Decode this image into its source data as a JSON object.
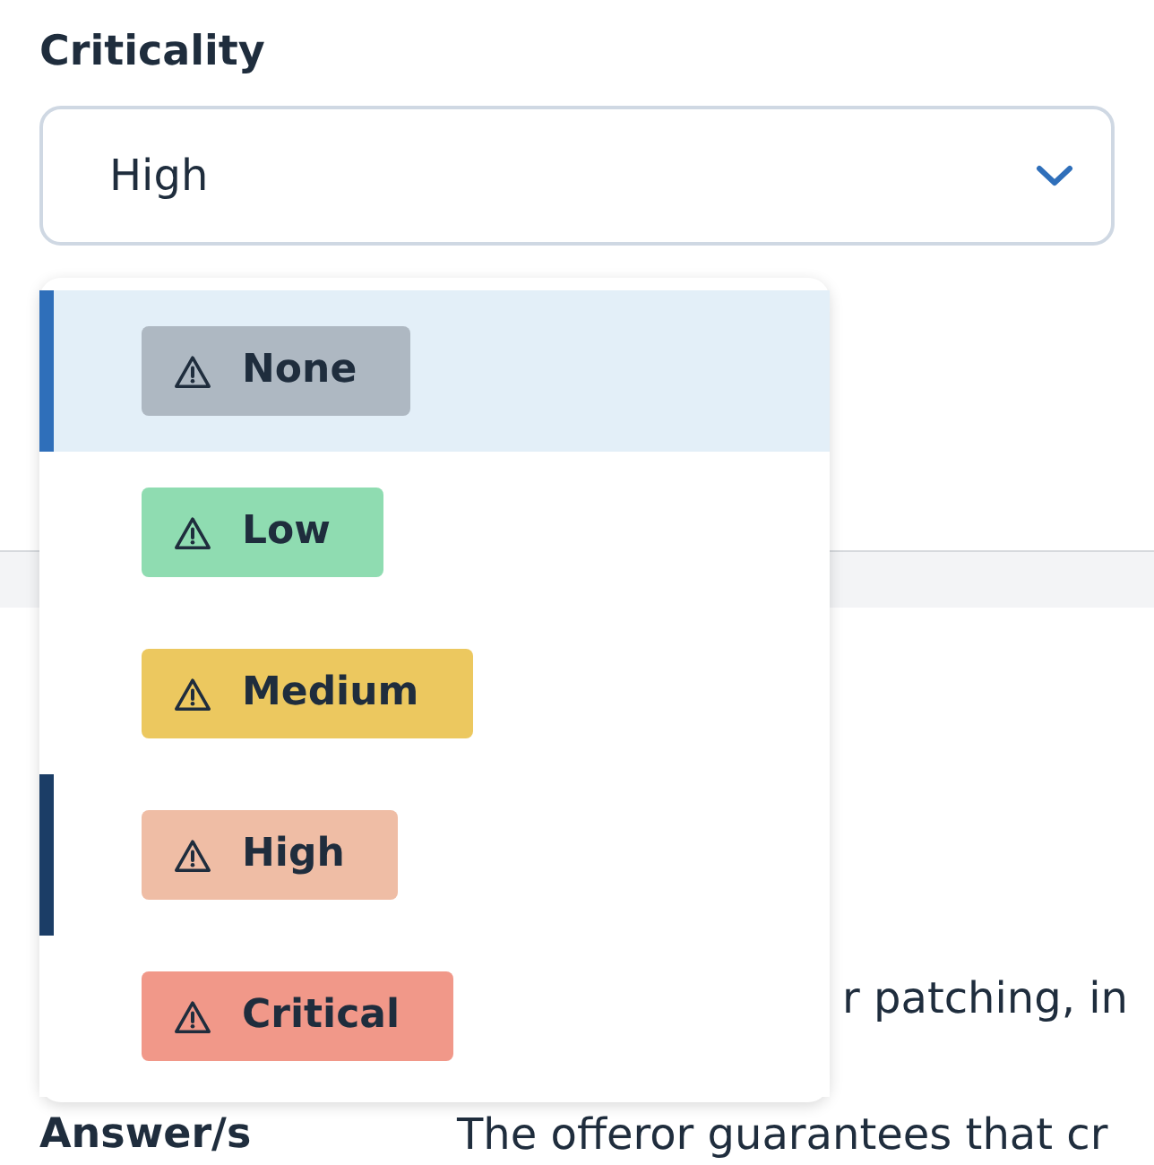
{
  "field": {
    "label": "Criticality",
    "value": "High"
  },
  "menu": {
    "options": [
      {
        "label": "None",
        "color": "#aeb8c2",
        "highlighted": true,
        "selected": false
      },
      {
        "label": "Low",
        "color": "#8fdcb1",
        "highlighted": false,
        "selected": false
      },
      {
        "label": "Medium",
        "color": "#ecc85f",
        "highlighted": false,
        "selected": false
      },
      {
        "label": "High",
        "color": "#efbda5",
        "highlighted": false,
        "selected": true
      },
      {
        "label": "Critical",
        "color": "#f19889",
        "highlighted": false,
        "selected": false
      }
    ]
  },
  "details": {
    "rows": [
      {
        "value": "r patching, in"
      },
      {
        "label": "Answer/s",
        "value": "The offeror guarantees that cr"
      }
    ]
  }
}
